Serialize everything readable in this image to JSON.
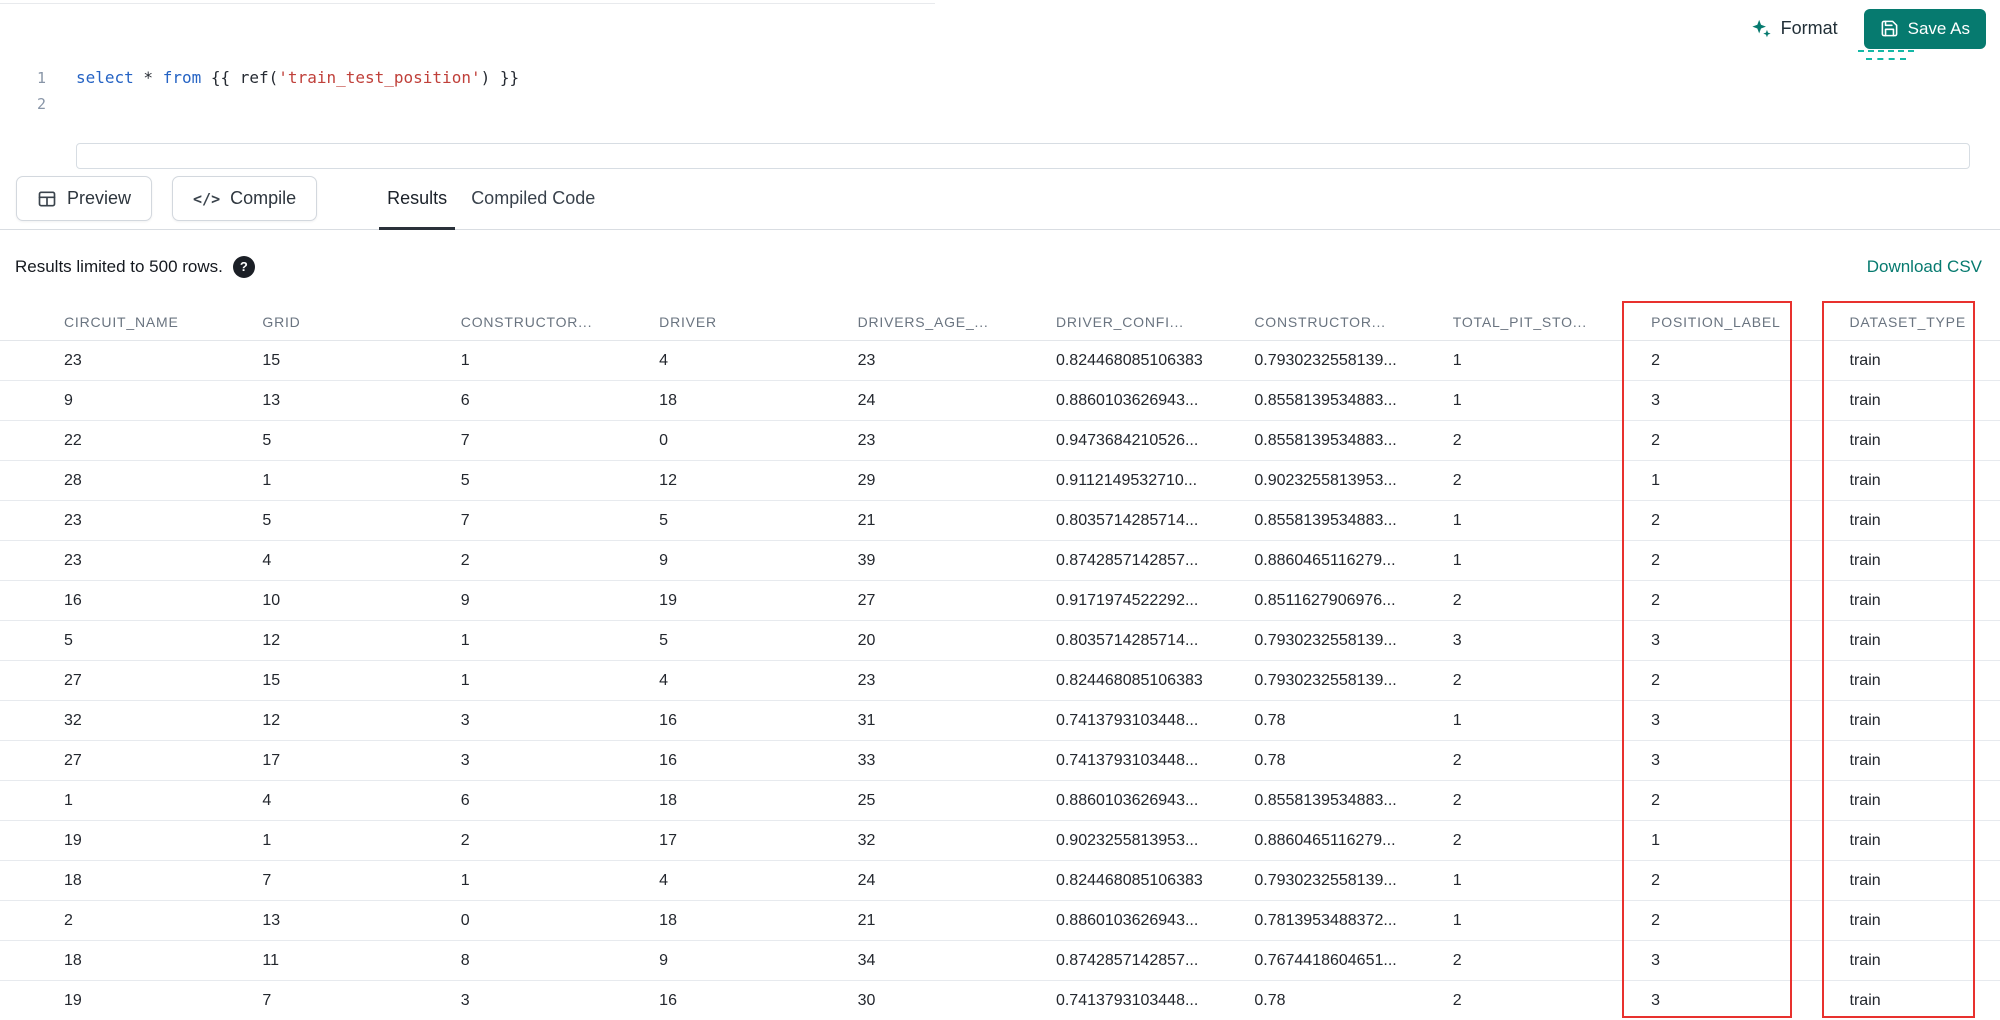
{
  "colors": {
    "accent": "#067a6f",
    "highlight": "#e8312e",
    "code_keyword": "#2563c4",
    "code_string": "#c0403a",
    "code_plain": "#262b33"
  },
  "topbar": {
    "format_label": "Format",
    "save_as_label": "Save As"
  },
  "editor": {
    "line_numbers": [
      "1",
      "2"
    ],
    "code_tokens": [
      {
        "type": "keyword",
        "text": "select"
      },
      {
        "type": "plain",
        "text": " * "
      },
      {
        "type": "keyword",
        "text": "from"
      },
      {
        "type": "plain",
        "text": " {{ ref("
      },
      {
        "type": "string",
        "text": "'train_test_position'"
      },
      {
        "type": "plain",
        "text": ") }}"
      }
    ]
  },
  "toolbar": {
    "preview_label": "Preview",
    "compile_label": "Compile",
    "compile_icon_text": "</>"
  },
  "tabs": [
    {
      "label": "Results",
      "active": true
    },
    {
      "label": "Compiled Code",
      "active": false
    }
  ],
  "results_bar": {
    "limit_text": "Results limited to 500 rows.",
    "help_glyph": "?",
    "download_label": "Download CSV"
  },
  "table": {
    "columns": [
      "CIRCUIT_NAME",
      "GRID",
      "CONSTRUCTOR...",
      "DRIVER",
      "DRIVERS_AGE_...",
      "DRIVER_CONFI...",
      "CONSTRUCTOR...",
      "TOTAL_PIT_STO...",
      "POSITION_LABEL",
      "DATASET_TYPE"
    ],
    "rows": [
      [
        "23",
        "15",
        "1",
        "4",
        "23",
        "0.824468085106383",
        "0.7930232558139...",
        "1",
        "2",
        "train"
      ],
      [
        "9",
        "13",
        "6",
        "18",
        "24",
        "0.8860103626943...",
        "0.8558139534883...",
        "1",
        "3",
        "train"
      ],
      [
        "22",
        "5",
        "7",
        "0",
        "23",
        "0.9473684210526...",
        "0.8558139534883...",
        "2",
        "2",
        "train"
      ],
      [
        "28",
        "1",
        "5",
        "12",
        "29",
        "0.9112149532710...",
        "0.9023255813953...",
        "2",
        "1",
        "train"
      ],
      [
        "23",
        "5",
        "7",
        "5",
        "21",
        "0.8035714285714...",
        "0.8558139534883...",
        "1",
        "2",
        "train"
      ],
      [
        "23",
        "4",
        "2",
        "9",
        "39",
        "0.8742857142857...",
        "0.8860465116279...",
        "1",
        "2",
        "train"
      ],
      [
        "16",
        "10",
        "9",
        "19",
        "27",
        "0.9171974522292...",
        "0.8511627906976...",
        "2",
        "2",
        "train"
      ],
      [
        "5",
        "12",
        "1",
        "5",
        "20",
        "0.8035714285714...",
        "0.7930232558139...",
        "3",
        "3",
        "train"
      ],
      [
        "27",
        "15",
        "1",
        "4",
        "23",
        "0.824468085106383",
        "0.7930232558139...",
        "2",
        "2",
        "train"
      ],
      [
        "32",
        "12",
        "3",
        "16",
        "31",
        "0.7413793103448...",
        "0.78",
        "1",
        "3",
        "train"
      ],
      [
        "27",
        "17",
        "3",
        "16",
        "33",
        "0.7413793103448...",
        "0.78",
        "2",
        "3",
        "train"
      ],
      [
        "1",
        "4",
        "6",
        "18",
        "25",
        "0.8860103626943...",
        "0.8558139534883...",
        "2",
        "2",
        "train"
      ],
      [
        "19",
        "1",
        "2",
        "17",
        "32",
        "0.9023255813953...",
        "0.8860465116279...",
        "2",
        "1",
        "train"
      ],
      [
        "18",
        "7",
        "1",
        "4",
        "24",
        "0.824468085106383",
        "0.7930232558139...",
        "1",
        "2",
        "train"
      ],
      [
        "2",
        "13",
        "0",
        "18",
        "21",
        "0.8860103626943...",
        "0.7813953488372...",
        "1",
        "2",
        "train"
      ],
      [
        "18",
        "11",
        "8",
        "9",
        "34",
        "0.8742857142857...",
        "0.7674418604651...",
        "2",
        "3",
        "train"
      ],
      [
        "19",
        "7",
        "3",
        "16",
        "30",
        "0.7413793103448...",
        "0.78",
        "2",
        "3",
        "train"
      ]
    ]
  },
  "annotations": {
    "highlighted_columns": [
      "POSITION_LABEL",
      "DATASET_TYPE"
    ]
  }
}
